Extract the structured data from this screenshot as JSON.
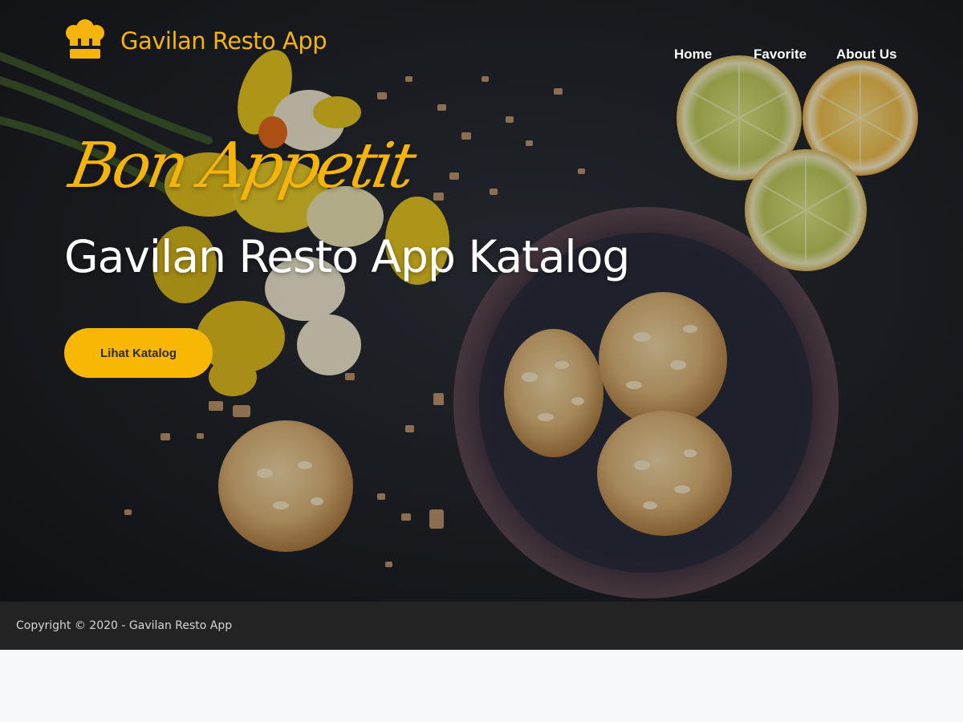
{
  "app": {
    "brand_name": "Gavilan Resto App",
    "brand_icon": "chef-hat-icon"
  },
  "nav": {
    "items": [
      {
        "label": "Home"
      },
      {
        "label": "Favorite"
      },
      {
        "label": "About Us"
      }
    ]
  },
  "hero": {
    "tagline": "Bon Appetit",
    "title": "Gavilan Resto App Katalog",
    "cta_label": "Lihat Katalog",
    "background": "food-photo-cookies-lemons-daffodils"
  },
  "footer": {
    "copyright": "Copyright © 2020 - Gavilan Resto App"
  },
  "colors": {
    "accent": "#f7b703",
    "hero_bg": "#1f2228",
    "footer_bg": "#232323",
    "page_bg": "#f7f8fc"
  }
}
